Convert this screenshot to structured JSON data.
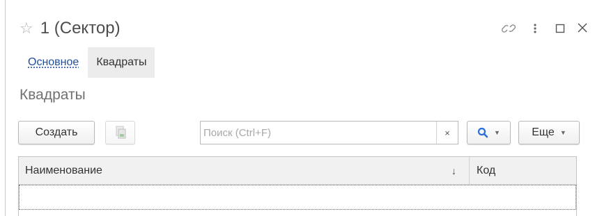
{
  "window": {
    "title": "1 (Сектор)",
    "star_icon": "☆",
    "icons": [
      "star-icon",
      "link-icon",
      "more-icon",
      "maximize-icon",
      "close-icon"
    ]
  },
  "tabs": [
    {
      "label": "Основное"
    },
    {
      "label": "Квадраты"
    }
  ],
  "section": {
    "title": "Квадраты"
  },
  "toolbar": {
    "create_label": "Создать",
    "search_placeholder": "Поиск (Ctrl+F)",
    "search_clear": "×",
    "search_caret": "▼",
    "more_label": "Еще",
    "more_caret": "▼"
  },
  "table": {
    "columns": [
      {
        "label": "Наименование",
        "sort_icon": "↓"
      },
      {
        "label": "Код"
      }
    ],
    "rows": []
  },
  "colors": {
    "link": "#1f4e9b",
    "search_icon": "#2a6fd6",
    "active_tab_bg": "#ececec"
  }
}
